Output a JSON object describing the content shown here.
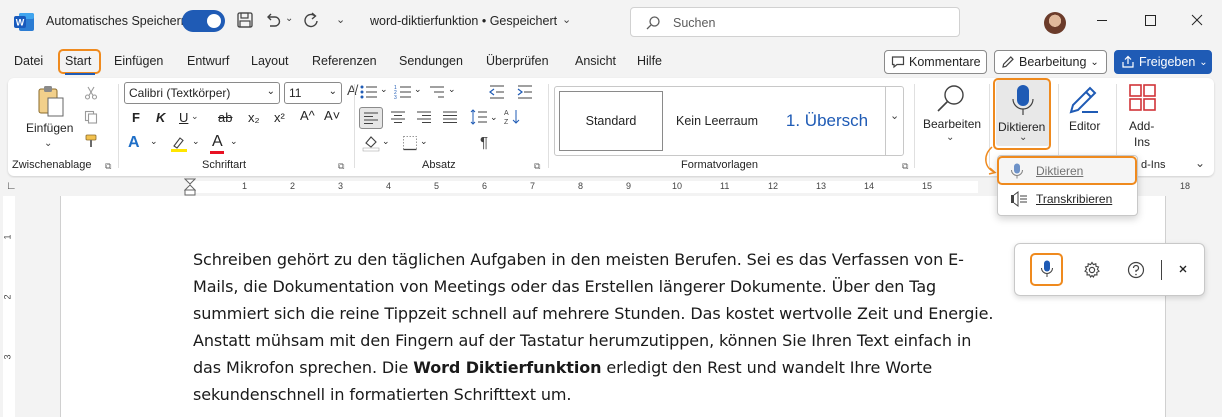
{
  "titlebar": {
    "autosave_label": "Automatisches Speichern",
    "autosave_on": true,
    "doc_title": "word-diktierfunktion • Gespeichert",
    "search_placeholder": "Suchen"
  },
  "tabs": [
    "Datei",
    "Start",
    "Einfügen",
    "Entwurf",
    "Layout",
    "Referenzen",
    "Sendungen",
    "Überprüfen",
    "Ansicht",
    "Hilfe"
  ],
  "active_tab": "Start",
  "actions": {
    "comments": "Kommentare",
    "editing": "Bearbeitung",
    "share": "Freigeben"
  },
  "ribbon": {
    "clipboard": {
      "paste": "Einfügen",
      "label": "Zwischenablage"
    },
    "font": {
      "name": "Calibri (Textkörper)",
      "size": "11",
      "label": "Schriftart",
      "bold": "F",
      "italic": "K",
      "underline": "U",
      "strike": "ab",
      "sub": "x₂",
      "sup": "x²",
      "grow": "A^",
      "shrink": "A˅",
      "clear": "A"
    },
    "paragraph": {
      "label": "Absatz"
    },
    "styles": {
      "items": [
        "Standard",
        "Kein Leerraum",
        "1.  Übersch"
      ],
      "label": "Formatvorlagen"
    },
    "editing_group": {
      "label": "Bearbeiten"
    },
    "voice": {
      "dictate": "Diktieren"
    },
    "editor": {
      "label": "Editor"
    },
    "addins": {
      "line1": "Add-",
      "line2": "Ins",
      "group_label": "d-Ins"
    }
  },
  "ruler_numbers": [
    "1",
    "2",
    "3",
    "4",
    "5",
    "6",
    "7",
    "8",
    "9",
    "10",
    "11",
    "12",
    "13",
    "14",
    "15",
    "18"
  ],
  "vruler_numbers": [
    "1",
    "2",
    "3"
  ],
  "dictate_menu": {
    "items": [
      {
        "label": "Diktieren",
        "selected": true
      },
      {
        "label": "Transkribieren",
        "selected": false
      }
    ]
  },
  "document": {
    "lines": [
      "Schreiben gehört zu den täglichen Aufgaben in den meisten Berufen. Sei es das Verfassen von E-",
      "Mails, die Dokumentation von Meetings oder das Erstellen längerer Dokumente. Über den Tag",
      "summiert sich die reine Tippzeit schnell auf mehrere Stunden. Das kostet wertvolle Zeit und Energie.",
      "Anstatt mühsam mit den Fingern auf der Tastatur herumzutippen, können Sie Ihren Text einfach in"
    ],
    "line5_pre": "das Mikrofon sprechen. Die ",
    "line5_bold": "Word Diktierfunktion",
    "line5_post": " erledigt den Rest und wandelt Ihre Worte",
    "line6": "sekundenschnell in formatierten Schrifttext um."
  },
  "colors": {
    "accent": "#1f5bb5",
    "highlight": "#ef8a1e",
    "word_blue": "#185abd"
  }
}
